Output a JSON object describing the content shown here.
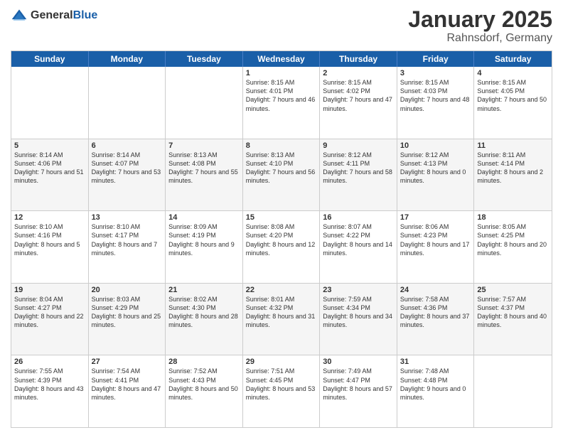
{
  "header": {
    "logo_general": "General",
    "logo_blue": "Blue",
    "month": "January 2025",
    "location": "Rahnsdorf, Germany"
  },
  "weekdays": [
    "Sunday",
    "Monday",
    "Tuesday",
    "Wednesday",
    "Thursday",
    "Friday",
    "Saturday"
  ],
  "rows": [
    [
      {
        "day": "",
        "text": ""
      },
      {
        "day": "",
        "text": ""
      },
      {
        "day": "",
        "text": ""
      },
      {
        "day": "1",
        "text": "Sunrise: 8:15 AM\nSunset: 4:01 PM\nDaylight: 7 hours and 46 minutes."
      },
      {
        "day": "2",
        "text": "Sunrise: 8:15 AM\nSunset: 4:02 PM\nDaylight: 7 hours and 47 minutes."
      },
      {
        "day": "3",
        "text": "Sunrise: 8:15 AM\nSunset: 4:03 PM\nDaylight: 7 hours and 48 minutes."
      },
      {
        "day": "4",
        "text": "Sunrise: 8:15 AM\nSunset: 4:05 PM\nDaylight: 7 hours and 50 minutes."
      }
    ],
    [
      {
        "day": "5",
        "text": "Sunrise: 8:14 AM\nSunset: 4:06 PM\nDaylight: 7 hours and 51 minutes."
      },
      {
        "day": "6",
        "text": "Sunrise: 8:14 AM\nSunset: 4:07 PM\nDaylight: 7 hours and 53 minutes."
      },
      {
        "day": "7",
        "text": "Sunrise: 8:13 AM\nSunset: 4:08 PM\nDaylight: 7 hours and 55 minutes."
      },
      {
        "day": "8",
        "text": "Sunrise: 8:13 AM\nSunset: 4:10 PM\nDaylight: 7 hours and 56 minutes."
      },
      {
        "day": "9",
        "text": "Sunrise: 8:12 AM\nSunset: 4:11 PM\nDaylight: 7 hours and 58 minutes."
      },
      {
        "day": "10",
        "text": "Sunrise: 8:12 AM\nSunset: 4:13 PM\nDaylight: 8 hours and 0 minutes."
      },
      {
        "day": "11",
        "text": "Sunrise: 8:11 AM\nSunset: 4:14 PM\nDaylight: 8 hours and 2 minutes."
      }
    ],
    [
      {
        "day": "12",
        "text": "Sunrise: 8:10 AM\nSunset: 4:16 PM\nDaylight: 8 hours and 5 minutes."
      },
      {
        "day": "13",
        "text": "Sunrise: 8:10 AM\nSunset: 4:17 PM\nDaylight: 8 hours and 7 minutes."
      },
      {
        "day": "14",
        "text": "Sunrise: 8:09 AM\nSunset: 4:19 PM\nDaylight: 8 hours and 9 minutes."
      },
      {
        "day": "15",
        "text": "Sunrise: 8:08 AM\nSunset: 4:20 PM\nDaylight: 8 hours and 12 minutes."
      },
      {
        "day": "16",
        "text": "Sunrise: 8:07 AM\nSunset: 4:22 PM\nDaylight: 8 hours and 14 minutes."
      },
      {
        "day": "17",
        "text": "Sunrise: 8:06 AM\nSunset: 4:23 PM\nDaylight: 8 hours and 17 minutes."
      },
      {
        "day": "18",
        "text": "Sunrise: 8:05 AM\nSunset: 4:25 PM\nDaylight: 8 hours and 20 minutes."
      }
    ],
    [
      {
        "day": "19",
        "text": "Sunrise: 8:04 AM\nSunset: 4:27 PM\nDaylight: 8 hours and 22 minutes."
      },
      {
        "day": "20",
        "text": "Sunrise: 8:03 AM\nSunset: 4:29 PM\nDaylight: 8 hours and 25 minutes."
      },
      {
        "day": "21",
        "text": "Sunrise: 8:02 AM\nSunset: 4:30 PM\nDaylight: 8 hours and 28 minutes."
      },
      {
        "day": "22",
        "text": "Sunrise: 8:01 AM\nSunset: 4:32 PM\nDaylight: 8 hours and 31 minutes."
      },
      {
        "day": "23",
        "text": "Sunrise: 7:59 AM\nSunset: 4:34 PM\nDaylight: 8 hours and 34 minutes."
      },
      {
        "day": "24",
        "text": "Sunrise: 7:58 AM\nSunset: 4:36 PM\nDaylight: 8 hours and 37 minutes."
      },
      {
        "day": "25",
        "text": "Sunrise: 7:57 AM\nSunset: 4:37 PM\nDaylight: 8 hours and 40 minutes."
      }
    ],
    [
      {
        "day": "26",
        "text": "Sunrise: 7:55 AM\nSunset: 4:39 PM\nDaylight: 8 hours and 43 minutes."
      },
      {
        "day": "27",
        "text": "Sunrise: 7:54 AM\nSunset: 4:41 PM\nDaylight: 8 hours and 47 minutes."
      },
      {
        "day": "28",
        "text": "Sunrise: 7:52 AM\nSunset: 4:43 PM\nDaylight: 8 hours and 50 minutes."
      },
      {
        "day": "29",
        "text": "Sunrise: 7:51 AM\nSunset: 4:45 PM\nDaylight: 8 hours and 53 minutes."
      },
      {
        "day": "30",
        "text": "Sunrise: 7:49 AM\nSunset: 4:47 PM\nDaylight: 8 hours and 57 minutes."
      },
      {
        "day": "31",
        "text": "Sunrise: 7:48 AM\nSunset: 4:48 PM\nDaylight: 9 hours and 0 minutes."
      },
      {
        "day": "",
        "text": ""
      }
    ]
  ]
}
